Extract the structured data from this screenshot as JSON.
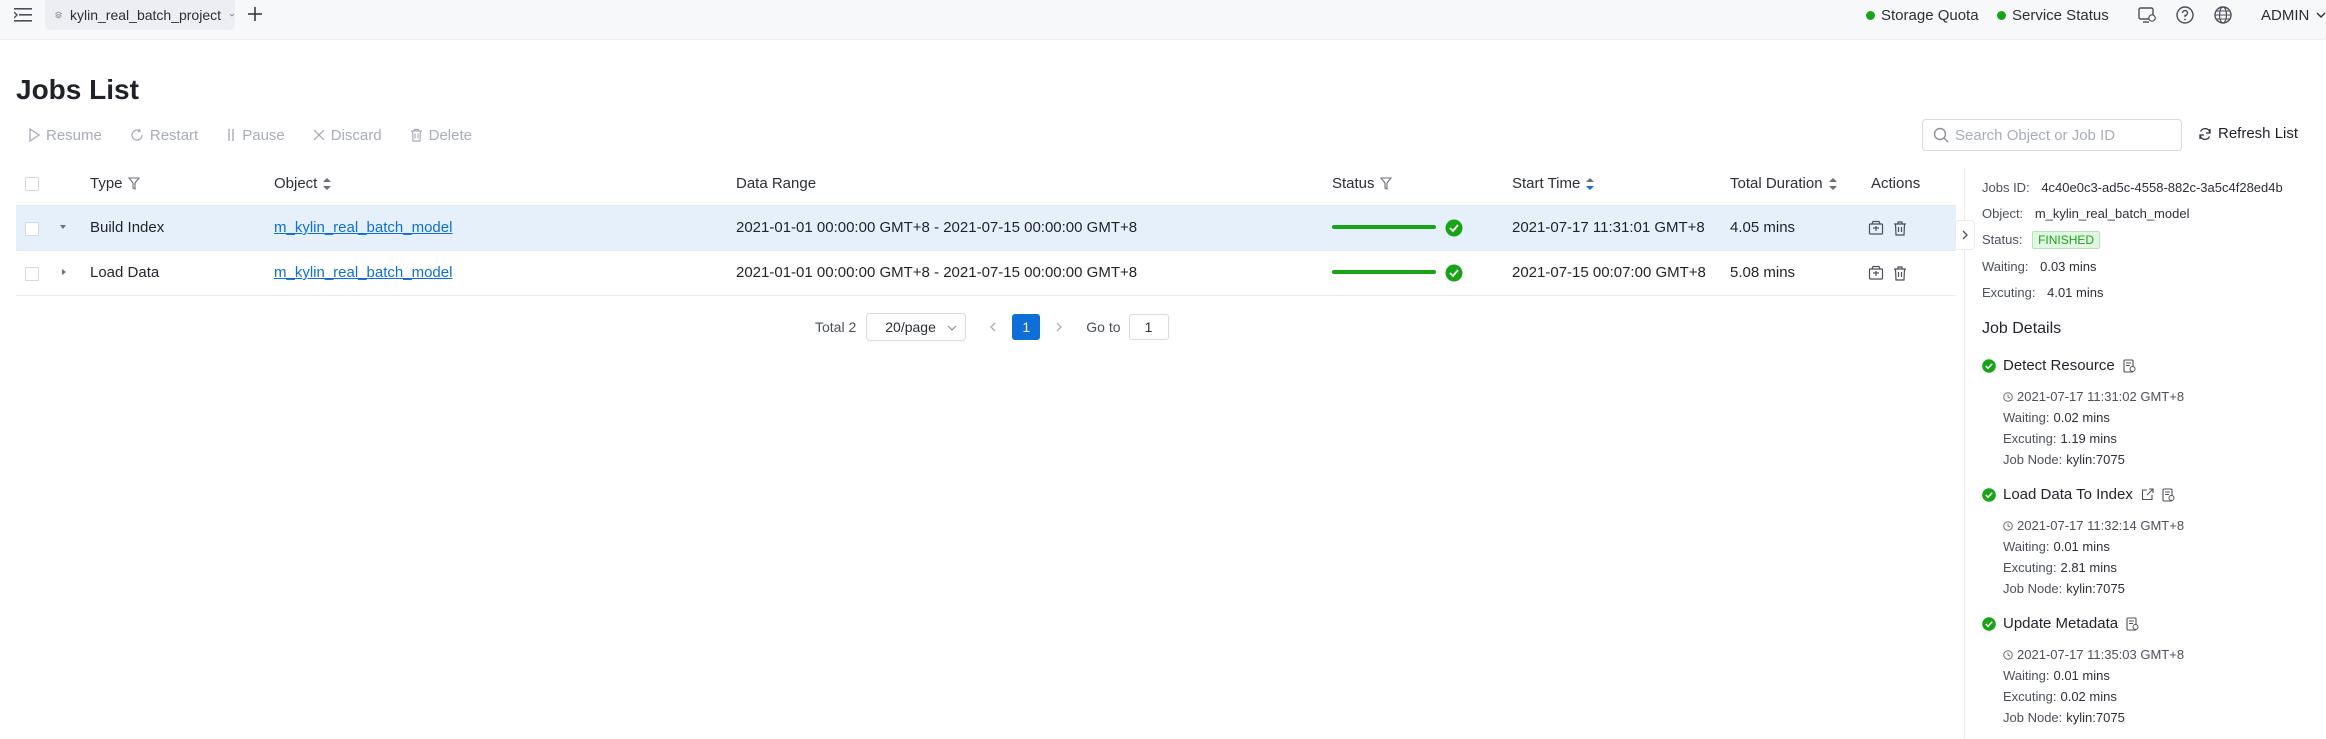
{
  "topbar": {
    "project_name": "kylin_real_batch_project",
    "storage_quota": "Storage Quota",
    "service_status": "Service Status",
    "user": "ADMIN",
    "status_color": "#19a319"
  },
  "page": {
    "title": "Jobs List"
  },
  "toolbar": {
    "resume": "Resume",
    "restart": "Restart",
    "pause": "Pause",
    "discard": "Discard",
    "delete": "Delete",
    "search_placeholder": "Search Object or Job ID",
    "refresh": "Refresh List"
  },
  "table": {
    "headers": {
      "type": "Type",
      "object": "Object",
      "data_range": "Data Range",
      "status": "Status",
      "start_time": "Start Time",
      "total_duration": "Total Duration",
      "actions": "Actions"
    },
    "rows": [
      {
        "type": "Build Index",
        "object": "m_kylin_real_batch_model",
        "data_range": "2021-01-01 00:00:00 GMT+8 - 2021-07-15 00:00:00 GMT+8",
        "progress": 1.0,
        "start_time": "2021-07-17 11:31:01 GMT+8",
        "duration": "4.05 mins",
        "expanded": true
      },
      {
        "type": "Load Data",
        "object": "m_kylin_real_batch_model",
        "data_range": "2021-01-01 00:00:00 GMT+8 - 2021-07-15 00:00:00 GMT+8",
        "progress": 1.0,
        "start_time": "2021-07-15 00:07:00 GMT+8",
        "duration": "5.08 mins",
        "expanded": false
      }
    ]
  },
  "pagination": {
    "total": "Total 2",
    "page_size": "20/page",
    "current": "1",
    "goto_label": "Go to",
    "goto_value": "1",
    "accent": "#0f6fd8"
  },
  "detail": {
    "job_id_label": "Jobs ID:",
    "job_id": "4c40e0c3-ad5c-4558-882c-3a5c4f28ed4b",
    "object_label": "Object:",
    "object": "m_kylin_real_batch_model",
    "status_label": "Status:",
    "status": "FINISHED",
    "waiting_label": "Waiting:",
    "waiting": "0.03 mins",
    "exec_label": "Excuting:",
    "exec": "4.01 mins",
    "details_heading": "Job Details",
    "steps": [
      {
        "name": "Detect Resource",
        "time": "2021-07-17 11:31:02 GMT+8",
        "waiting": "0.02 mins",
        "exec": "1.19 mins",
        "node": "kylin:7075"
      },
      {
        "name": "Load Data To Index",
        "time": "2021-07-17 11:32:14 GMT+8",
        "waiting": "0.01 mins",
        "exec": "2.81 mins",
        "node": "kylin:7075"
      },
      {
        "name": "Update Metadata",
        "time": "2021-07-17 11:35:03 GMT+8",
        "waiting": "0.01 mins",
        "exec": "0.02 mins",
        "node": "kylin:7075"
      }
    ],
    "step_waiting_label": "Waiting:",
    "step_exec_label": "Excuting:",
    "step_node_label": "Job Node:"
  }
}
